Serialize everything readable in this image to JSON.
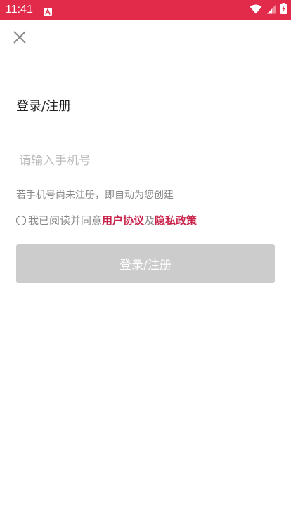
{
  "status_bar": {
    "time": "11:41",
    "background_color": "#e22b4b",
    "icons": [
      "app-notification-icon",
      "wifi-icon",
      "signal-icon",
      "battery-charging-icon"
    ]
  },
  "header": {
    "close_icon": "close-icon"
  },
  "login": {
    "title": "登录/注册",
    "phone_placeholder": "请输入手机号",
    "hint": "若手机号尚未注册，即自动为您创建",
    "agreement_prefix": "我已阅读并同意",
    "user_agreement": "用户协议",
    "conjunction": "及",
    "privacy_policy": "隐私政策",
    "submit_label": "登录/注册"
  },
  "colors": {
    "accent": "#c8234a",
    "button_disabled": "#cccccc",
    "hint_text": "#888888"
  }
}
